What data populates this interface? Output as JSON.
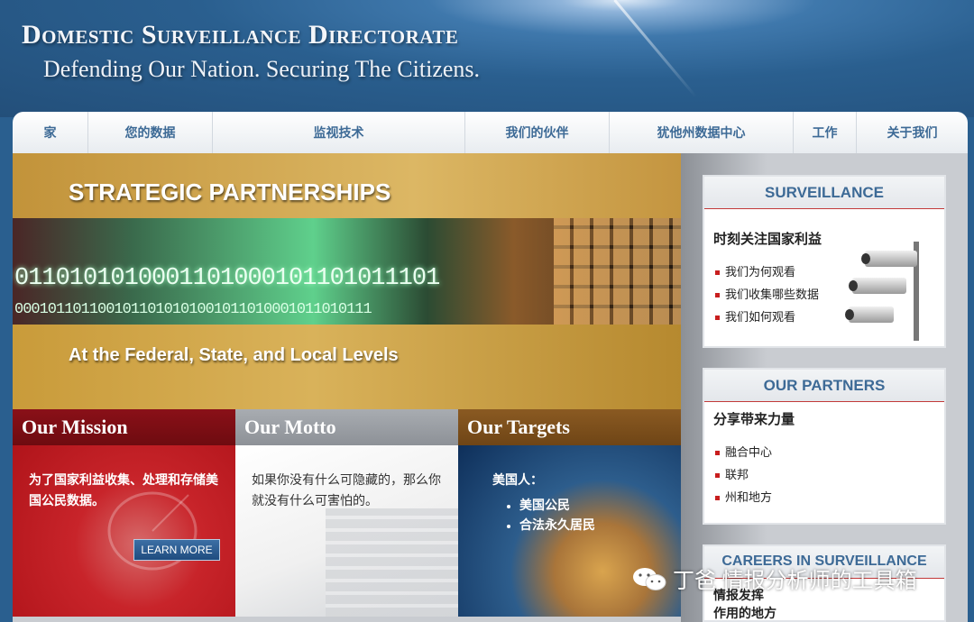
{
  "header": {
    "title": "Domestic Surveillance Directorate",
    "tagline": "Defending Our Nation.  Securing The Citizens."
  },
  "nav": {
    "items": [
      "家",
      "您的数据",
      "监视技术",
      "我们的伙伴",
      "犹他州数据中心",
      "工作",
      "关于我们"
    ]
  },
  "banner": {
    "title": "STRATEGIC PARTNERSHIPS",
    "binary_line1": "0110101010001101000101101011101",
    "binary_line2": "0001011011001011010101001011010001011010111",
    "subtitle": "At the Federal, State, and Local Levels"
  },
  "panels": {
    "mission": {
      "heading": "Our Mission",
      "text": "为了国家利益收集、处理和存储美国公民数据。",
      "button": "LEARN MORE"
    },
    "motto": {
      "heading": "Our Motto",
      "text": "如果你没有什么可隐藏的，那么你就没有什么可害怕的。"
    },
    "targets": {
      "heading": "Our Targets",
      "intro": "美国人：",
      "items": [
        "美国公民",
        "合法永久居民"
      ]
    }
  },
  "sidebar": {
    "surveillance": {
      "heading": "SURVEILLANCE",
      "subheading": "时刻关注国家利益",
      "links": [
        "我们为何观看",
        "我们收集哪些数据",
        "我们如何观看"
      ]
    },
    "partners": {
      "heading": "OUR PARTNERS",
      "subheading": "分享带来力量",
      "links": [
        "融合中心",
        "联邦",
        "州和地方"
      ]
    },
    "careers": {
      "heading": "CAREERS IN SURVEILLANCE",
      "line1": "情报发挥",
      "line2": "作用的地方"
    }
  },
  "watermark": {
    "text": "丁爸 情报分析师的工具箱",
    "icon": "wechat-icon"
  },
  "colors": {
    "nav_text": "#3d6a96",
    "mission_red": "#b0141a",
    "header_blue": "#2a5f8f",
    "bullet_red": "#c81e1e"
  }
}
